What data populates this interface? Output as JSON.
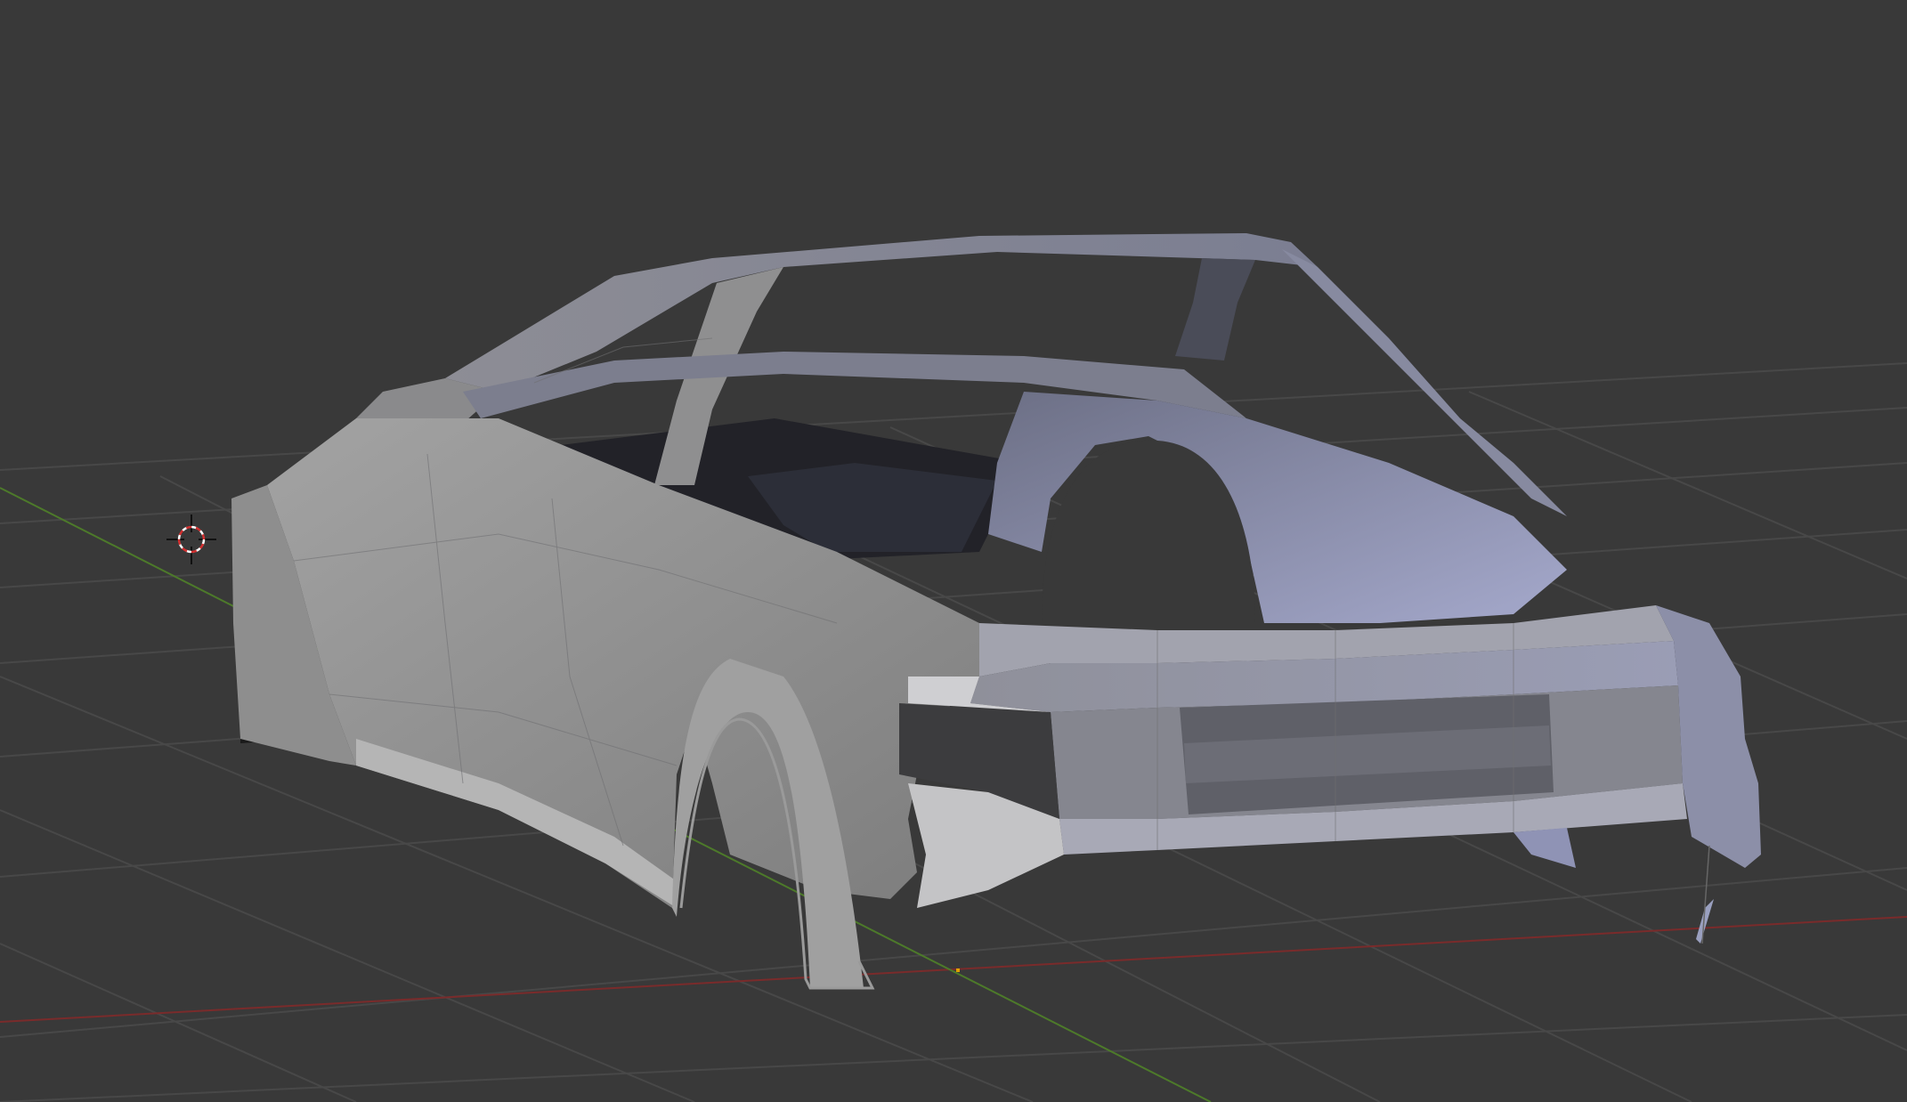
{
  "viewport": {
    "background": "#393939",
    "grid_color": "#4a4a4a",
    "x_axis_color": "#8a2e2e",
    "y_axis_color": "#4f7a2c",
    "origin_color": "#e0a000",
    "cursor_icon": "3d-cursor-icon"
  },
  "model": {
    "object_color": "#9a9a9c",
    "selected_tint": "#9ba0c0"
  }
}
